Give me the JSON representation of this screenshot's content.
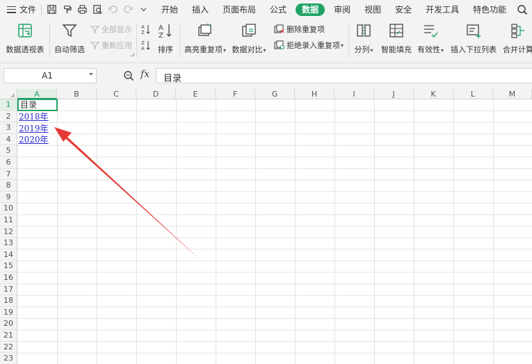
{
  "menu": {
    "file_label": "文件",
    "tabs": [
      {
        "label": "开始",
        "active": false
      },
      {
        "label": "插入",
        "active": false
      },
      {
        "label": "页面布局",
        "active": false
      },
      {
        "label": "公式",
        "active": false
      },
      {
        "label": "数据",
        "active": true
      },
      {
        "label": "审阅",
        "active": false
      },
      {
        "label": "视图",
        "active": false
      },
      {
        "label": "安全",
        "active": false
      },
      {
        "label": "开发工具",
        "active": false
      },
      {
        "label": "特色功能",
        "active": false
      }
    ],
    "quick_access_icons": [
      "save-icon",
      "format-painter-icon",
      "print-icon",
      "print-preview-icon",
      "undo-icon",
      "redo-icon",
      "more-icon"
    ]
  },
  "ribbon": {
    "pivot_table": "数据透视表",
    "auto_filter": "自动筛选",
    "show_all": "全部显示",
    "reapply": "重新应用",
    "sort": "排序",
    "highlight_duplicates": "高亮重复项",
    "data_compare": "数据对比",
    "remove_duplicates": "删除重复项",
    "reject_duplicates": "拒绝录入重复项",
    "split": "分列",
    "smart_fill": "智能填充",
    "validation": "有效性",
    "insert_dropdown": "插入下拉列表",
    "consolidate": "合并计算"
  },
  "formula_bar": {
    "name_box": "A1",
    "fx_label": "fx",
    "content": "目录"
  },
  "sheet": {
    "columns": [
      "A",
      "B",
      "C",
      "D",
      "E",
      "F",
      "G",
      "H",
      "I",
      "J",
      "K",
      "L",
      "M"
    ],
    "rows": [
      "1",
      "2",
      "3",
      "4",
      "5",
      "6",
      "7",
      "8",
      "9",
      "10",
      "11",
      "12",
      "13",
      "14",
      "15",
      "16",
      "17",
      "18",
      "19",
      "20",
      "21",
      "22",
      "23"
    ],
    "selected_cell": "A1",
    "cells": {
      "a1": "目录",
      "a2": "2018年",
      "a3": "2019年",
      "a4": "2020年"
    }
  },
  "colors": {
    "accent": "#21a366",
    "hyperlink": "#2a2ad0",
    "arrow": "#e53935"
  },
  "annotation": {
    "type": "arrow",
    "color": "#e53935",
    "points_to": "A3"
  }
}
